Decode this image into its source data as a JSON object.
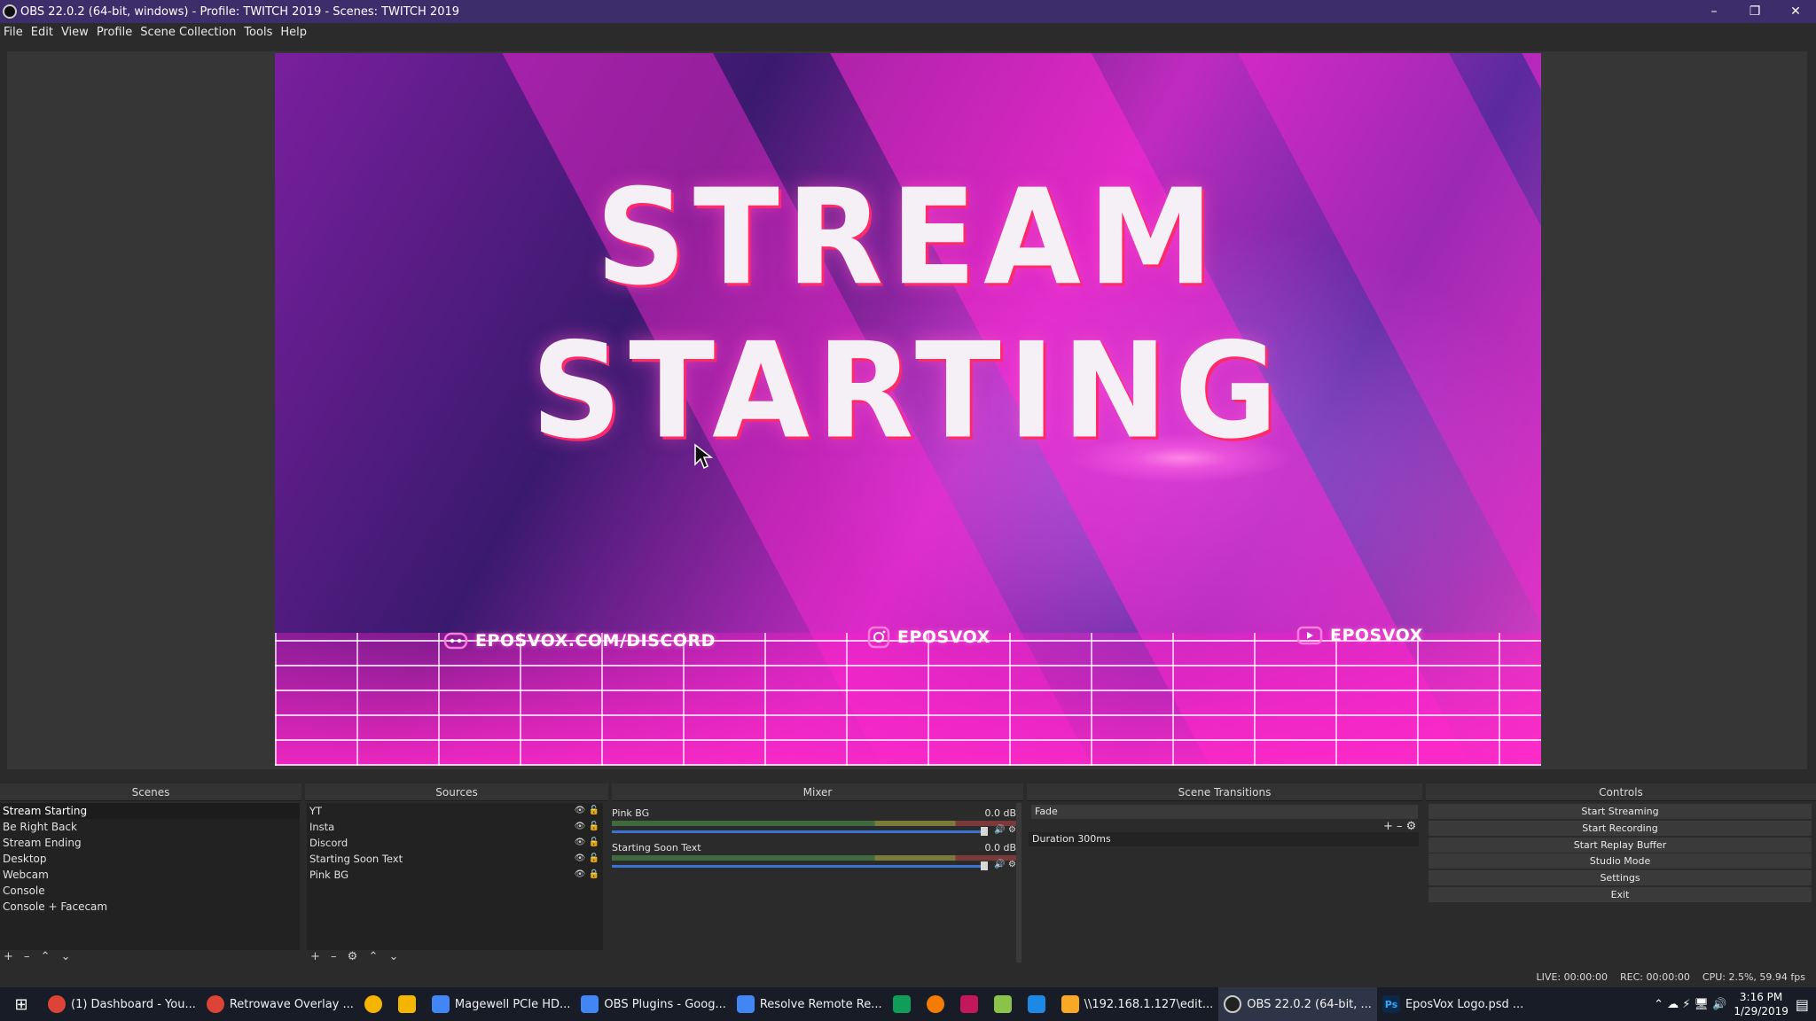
{
  "window": {
    "title": "OBS 22.0.2 (64-bit, windows) - Profile: TWITCH 2019 - Scenes: TWITCH 2019",
    "minimize_glyph": "–",
    "maximize_glyph": "❐",
    "close_glyph": "✕"
  },
  "menu": [
    "File",
    "Edit",
    "View",
    "Profile",
    "Scene Collection",
    "Tools",
    "Help"
  ],
  "preview": {
    "headline": "STREAM STARTING",
    "socials": [
      {
        "icon": "discord-icon",
        "text": "EPOSVOX.COM/DISCORD"
      },
      {
        "icon": "instagram-icon",
        "text": "EPOSVOX"
      },
      {
        "icon": "youtube-icon",
        "text": "EPOSVOX"
      }
    ]
  },
  "docks": {
    "scenes": {
      "title": "Scenes",
      "items": [
        "Stream Starting",
        "Be Right Back",
        "Stream Ending",
        "Desktop",
        "Webcam",
        "Console",
        "Console + Facecam"
      ],
      "toolbar": "+ – ⌃ ⌄"
    },
    "sources": {
      "title": "Sources",
      "items": [
        "YT",
        "Insta",
        "Discord",
        "Starting Soon Text",
        "Pink BG"
      ],
      "toolbar": "+ – ⚙ ⌃ ⌄"
    },
    "mixer": {
      "title": "Mixer",
      "channels": [
        {
          "name": "Pink BG",
          "db": "0.0 dB"
        },
        {
          "name": "Starting Soon Text",
          "db": "0.0 dB"
        }
      ]
    },
    "transitions": {
      "title": "Scene Transitions",
      "selected": "Fade",
      "duration_label": "Duration",
      "duration_value": "300ms"
    },
    "controls": {
      "title": "Controls",
      "buttons": [
        "Start Streaming",
        "Start Recording",
        "Start Replay Buffer",
        "Studio Mode",
        "Settings",
        "Exit"
      ]
    }
  },
  "status": {
    "live": "LIVE: 00:00:00",
    "rec": "REC: 00:00:00",
    "cpu": "CPU: 2.5%, 59.94 fps"
  },
  "taskbar": {
    "items": [
      {
        "label": "(1) Dashboard - You...",
        "icon": "chrome-icon",
        "color": "#db4437"
      },
      {
        "label": "Retrowave Overlay ...",
        "icon": "chrome-icon",
        "color": "#db4437"
      },
      {
        "label": "",
        "icon": "chrome-icon",
        "color": "#f4b400"
      },
      {
        "label": "",
        "icon": "keep-icon",
        "color": "#f4b400"
      },
      {
        "label": "Magewell PCIe HD...",
        "icon": "docs-icon",
        "color": "#4285f4"
      },
      {
        "label": "OBS Plugins - Goog...",
        "icon": "docs-icon",
        "color": "#4285f4"
      },
      {
        "label": "Resolve Remote Re...",
        "icon": "docs-icon",
        "color": "#4285f4"
      },
      {
        "label": "",
        "icon": "sheets-icon",
        "color": "#0f9d58"
      },
      {
        "label": "",
        "icon": "app-icon",
        "color": "#f57c00"
      },
      {
        "label": "",
        "icon": "app-icon",
        "color": "#c2185b"
      },
      {
        "label": "",
        "icon": "app-icon",
        "color": "#8bc34a"
      },
      {
        "label": "",
        "icon": "app-icon",
        "color": "#1e88e5"
      },
      {
        "label": "\\\\192.168.1.127\\edit...",
        "icon": "folder-icon",
        "color": "#f9a825"
      },
      {
        "label": "OBS 22.0.2 (64-bit, ...",
        "icon": "obs-icon",
        "color": "#222222"
      },
      {
        "label": "EposVox Logo.psd ...",
        "icon": "photoshop-icon",
        "color": "#0b2a4a"
      }
    ],
    "clock_time": "3:16 PM",
    "clock_date": "1/29/2019",
    "photoshop_glyph": "Ps",
    "start_glyph": "⊞",
    "tray_glyphs": "⌃ ☁ ⚡ 🖥 🔊"
  },
  "colors": {
    "titlebar": "#3d2d6b",
    "accent_pink": "#ff2aa8",
    "slider_blue": "#3a73d4"
  }
}
